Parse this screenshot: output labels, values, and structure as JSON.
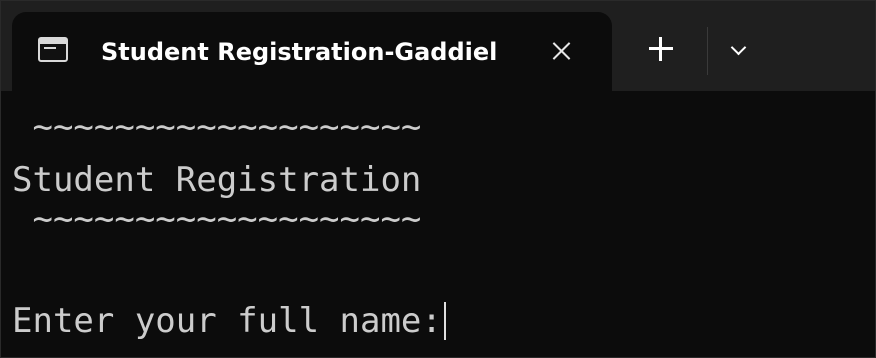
{
  "tab": {
    "title": "Student Registration-Gaddiel",
    "icon": "terminal-icon"
  },
  "toolbar": {
    "new_tab_icon": "plus-icon",
    "dropdown_icon": "chevron-down-icon",
    "close_icon": "close-icon"
  },
  "terminal": {
    "line1": " ~~~~~~~~~~~~~~~~~~~",
    "line2": "Student Registration",
    "line3": " ~~~~~~~~~~~~~~~~~~~",
    "prompt": "Enter your full name:"
  }
}
